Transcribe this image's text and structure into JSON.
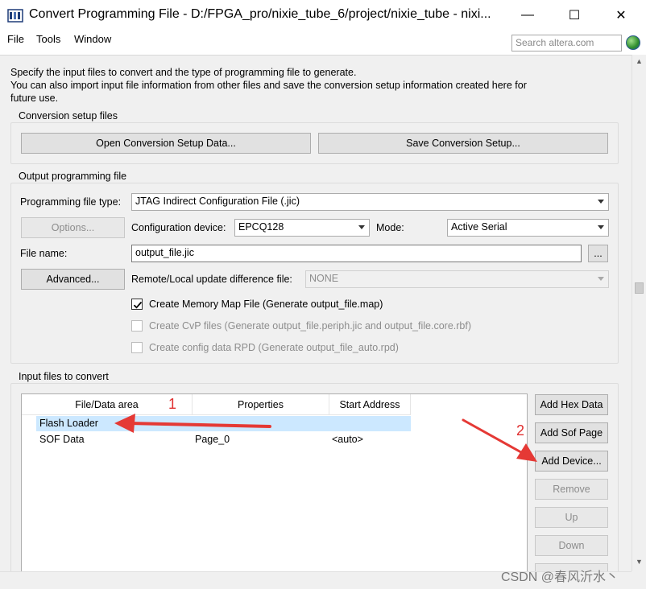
{
  "window": {
    "title": "Convert Programming File - D:/FPGA_pro/nixie_tube_6/project/nixie_tube - nixi...",
    "minimize_glyph": "—",
    "maximize_glyph": "☐",
    "close_glyph": "✕"
  },
  "menu": {
    "file": "File",
    "tools": "Tools",
    "window": "Window",
    "search_placeholder": "Search altera.com"
  },
  "intro": {
    "line1": "Specify the input files to convert and the type of programming file to generate.",
    "line2": "You can also import input file information from other files and save the conversion setup information created here for",
    "line3": "future use."
  },
  "conversion_setup": {
    "label": "Conversion setup files",
    "open_button": "Open Conversion Setup Data...",
    "save_button": "Save Conversion Setup..."
  },
  "output": {
    "label": "Output programming file",
    "prog_file_type_label": "Programming file type:",
    "prog_file_type_value": "JTAG Indirect Configuration File (.jic)",
    "options_button": "Options...",
    "config_device_label": "Configuration device:",
    "config_device_value": "EPCQ128",
    "mode_label": "Mode:",
    "mode_value": "Active Serial",
    "file_name_label": "File name:",
    "file_name_value": "output_file.jic",
    "browse_button": "...",
    "advanced_button": "Advanced...",
    "remote_label": "Remote/Local update difference file:",
    "remote_value": "NONE",
    "create_map_label": "Create Memory Map File (Generate output_file.map)",
    "create_map_checked": true,
    "create_cvp_label": "Create CvP files (Generate output_file.periph.jic and output_file.core.rbf)",
    "create_rpd_label": "Create config data RPD (Generate output_file_auto.rpd)"
  },
  "input_files": {
    "label": "Input files to convert",
    "columns": [
      "File/Data area",
      "Properties",
      "Start Address"
    ],
    "rows": [
      {
        "area": "Flash Loader",
        "properties": "",
        "start": ""
      },
      {
        "area": "SOF Data",
        "properties": "Page_0",
        "start": "<auto>"
      }
    ],
    "add_hex_button": "Add Hex Data",
    "add_sof_button": "Add Sof Page",
    "add_device_button": "Add Device...",
    "remove_button": "Remove",
    "up_button": "Up",
    "down_button": "Down"
  },
  "annotations": {
    "step1": "1",
    "step2": "2",
    "color": "#e53935"
  },
  "watermark": "CSDN @春风沂水丶"
}
